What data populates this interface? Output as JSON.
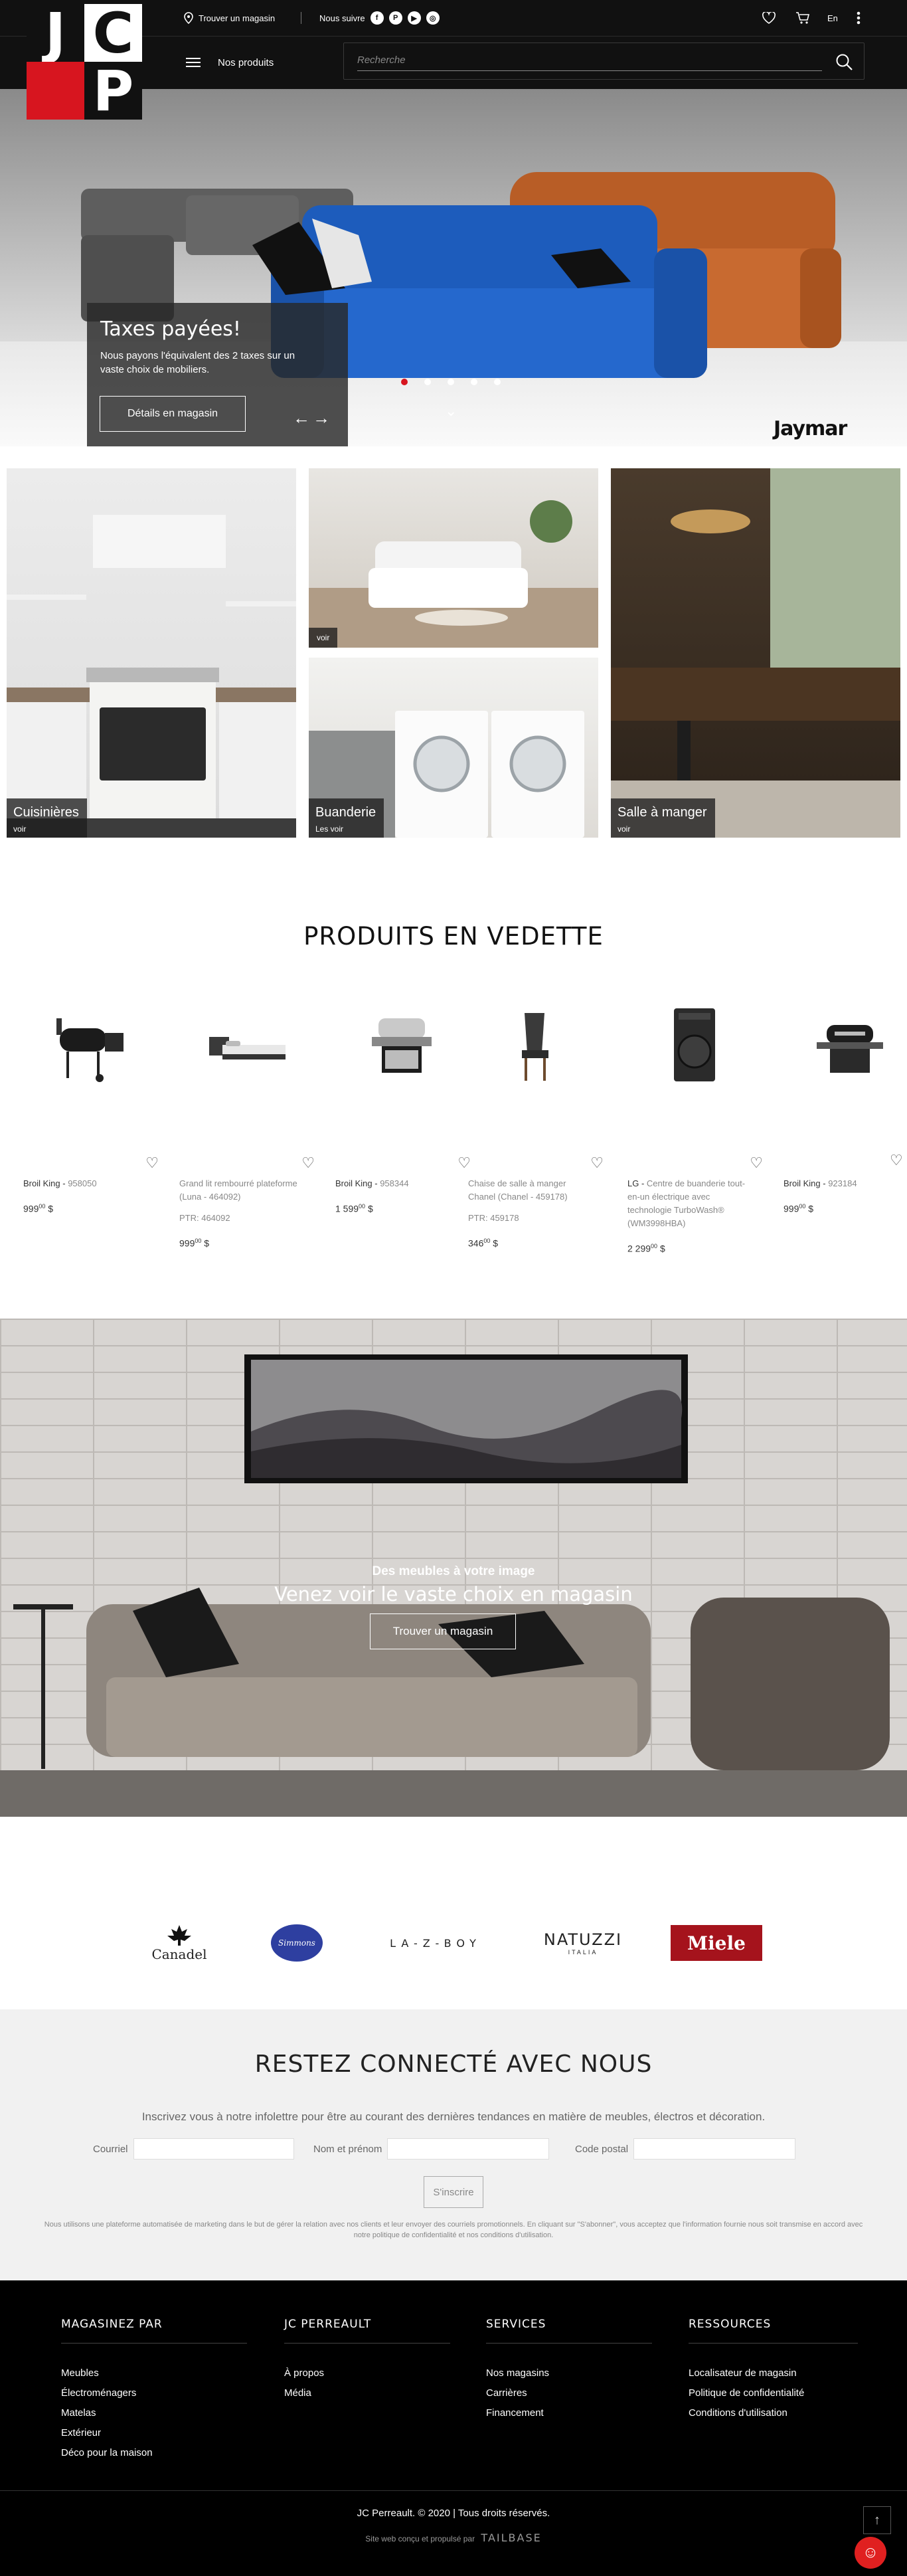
{
  "header": {
    "logo_letters": [
      "J",
      "C",
      "",
      "P"
    ],
    "find_store": "Trouver un magasin",
    "follow_us": "Nous suivre",
    "social": [
      "f",
      "P",
      "▶",
      "◎"
    ],
    "lang": "En",
    "products_menu": "Nos produits",
    "search_placeholder": "Recherche"
  },
  "hero": {
    "title": "Taxes payées!",
    "text": "Nous payons l'équivalent des 2 taxes sur un vaste choix de mobiliers.",
    "button": "Détails en magasin",
    "arrows": "←→",
    "brand": "Jaymar",
    "slides": 5,
    "active_slide": 1
  },
  "categories": [
    {
      "name": "Cuisinières",
      "link": "voir"
    },
    {
      "name": "",
      "link": "voir"
    },
    {
      "name": "Buanderie",
      "link": "Les voir"
    },
    {
      "name": "Salle à manger",
      "link": "voir"
    }
  ],
  "featured": {
    "title": "PRODUITS EN VEDETTE",
    "products": [
      {
        "brand": "Broil King",
        "sku": "958050",
        "name": "",
        "ptr": "",
        "price_main": "999",
        "price_cents": "00",
        "currency": "$"
      },
      {
        "brand": "",
        "sku": "",
        "name": "Grand lit rembourré plateforme (Luna - 464092)",
        "ptr": "PTR: 464092",
        "price_main": "999",
        "price_cents": "00",
        "currency": "$"
      },
      {
        "brand": "Broil King",
        "sku": "958344",
        "name": "",
        "ptr": "",
        "price_main": "1 599",
        "price_cents": "00",
        "currency": "$"
      },
      {
        "brand": "",
        "sku": "",
        "name": "Chaise de salle à manger Chanel (Chanel - 459178)",
        "ptr": "PTR: 459178",
        "price_main": "346",
        "price_cents": "00",
        "currency": "$"
      },
      {
        "brand": "LG",
        "sku": "",
        "name": "Centre de buanderie tout-en-un électrique avec technologie TurboWash® (WM3998HBA)",
        "ptr": "",
        "price_main": "2 299",
        "price_cents": "00",
        "currency": "$"
      },
      {
        "brand": "Broil King",
        "sku": "923184",
        "name": "",
        "ptr": "",
        "price_main": "999",
        "price_cents": "00",
        "currency": "$"
      }
    ]
  },
  "banner": {
    "subtitle": "Des meubles à votre image",
    "title": "Venez voir le vaste choix en magasin",
    "button": "Trouver un magasin"
  },
  "brands": {
    "canadel": "Canadel",
    "simmons": "Simmons",
    "lazboy": "LA-Z-BOY",
    "natuzzi": "NATUZZI",
    "natuzzi_sub": "ITALIA",
    "miele": "Miele"
  },
  "newsletter": {
    "title": "RESTEZ CONNECTÉ AVEC NOUS",
    "description": "Inscrivez vous à notre infolettre pour être au courant des dernières tendances en matière de meubles, électros et décoration.",
    "email_label": "Courriel",
    "name_label": "Nom et prénom",
    "postal_label": "Code postal",
    "button": "S'inscrire",
    "legal": "Nous utilisons une plateforme automatisée de marketing dans le but de gérer la relation avec nos clients et leur envoyer des courriels promotionnels. En cliquant sur \"S'abonner\", vous acceptez que l'information fournie nous soit transmise en accord avec notre politique de confidentialité et nos conditions d'utilisation."
  },
  "footer": {
    "columns": [
      {
        "title": "MAGASINEZ PAR",
        "links": [
          "Meubles",
          "Électroménagers",
          "Matelas",
          "Extérieur",
          "Déco pour la maison"
        ]
      },
      {
        "title": "JC PERREAULT",
        "links": [
          "À propos",
          "Média"
        ]
      },
      {
        "title": "SERVICES",
        "links": [
          "Nos magasins",
          "Carrières",
          "Financement"
        ]
      },
      {
        "title": "RESSOURCES",
        "links": [
          "Localisateur de magasin",
          "Politique de confidentialité",
          "Conditions d'utilisation"
        ]
      }
    ],
    "copyright": "JC Perreault. © 2020 | Tous droits réservés.",
    "made_by": "Site web conçu et propulsé par",
    "agency": "TAILBASE"
  },
  "colors": {
    "brand_red": "#d7151f",
    "dark": "#111111",
    "sofa_blue": "#1f5fbf",
    "sofa_orange": "#c0642a"
  }
}
